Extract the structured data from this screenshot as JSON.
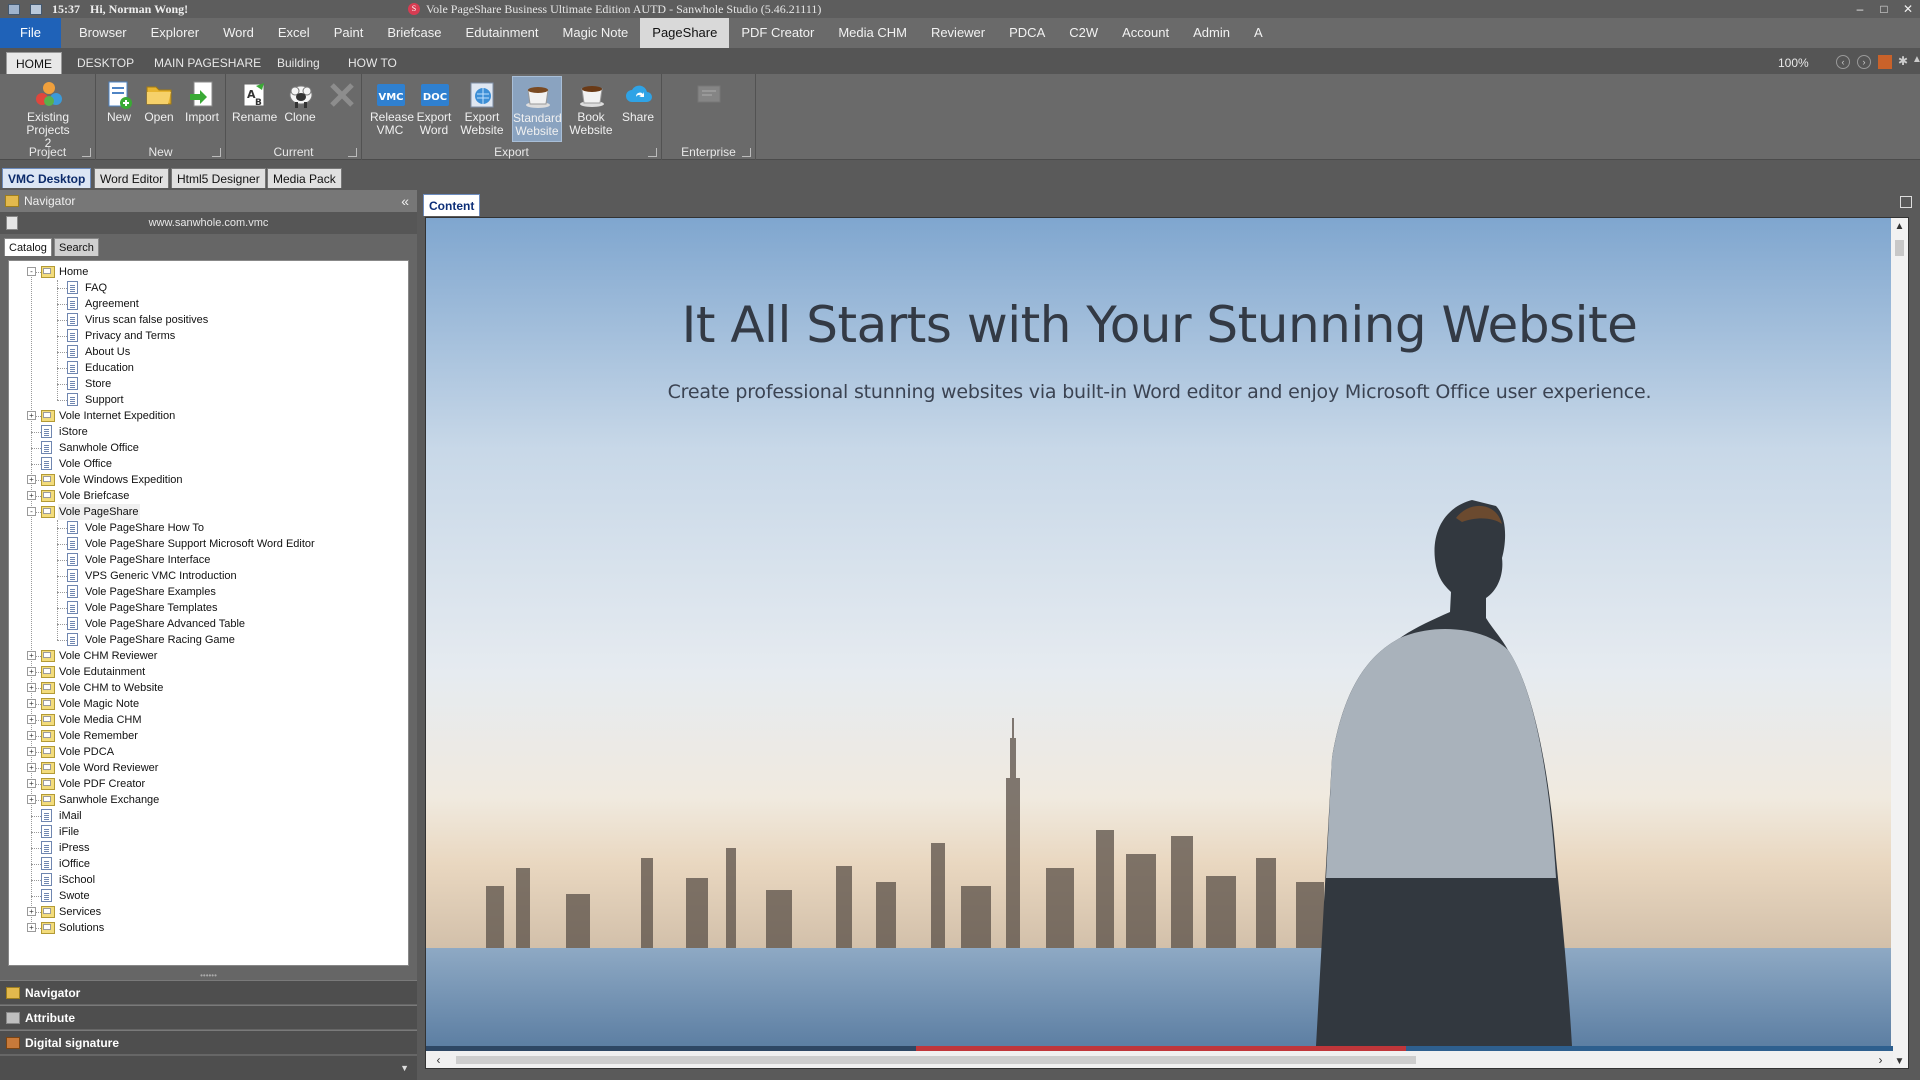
{
  "titlebar": {
    "time": "15:37",
    "greeting": "Hi, Norman Wong!",
    "window_title": "Vole PageShare Business Ultimate Edition AUTD - Sanwhole Studio (5.46.21111)",
    "minimize": "–",
    "maximize": "□",
    "close": "✕"
  },
  "menu": {
    "file": "File",
    "items": [
      "Browser",
      "Explorer",
      "Word",
      "Excel",
      "Paint",
      "Briefcase",
      "Edutainment",
      "Magic Note",
      "PageShare",
      "PDF Creator",
      "Media CHM",
      "Reviewer",
      "PDCA",
      "C2W",
      "Account",
      "Admin",
      "A"
    ],
    "active": "PageShare"
  },
  "subtabs": {
    "items": [
      "HOME",
      "DESKTOP",
      "MAIN PAGESHARE",
      "Building",
      "HOW TO"
    ],
    "active": "HOME",
    "zoom": "100%"
  },
  "ribbon": {
    "project": {
      "label": "Project",
      "existing_line1": "Existing Projects",
      "existing_line2": "2"
    },
    "new_group": {
      "label": "New",
      "new": "New",
      "open": "Open",
      "import": "Import"
    },
    "current": {
      "label": "Current",
      "rename": "Rename",
      "clone": "Clone"
    },
    "export": {
      "label": "Export",
      "release_1": "Release",
      "release_2": "VMC",
      "export_word_1": "Export",
      "export_word_2": "Word",
      "export_web_1": "Export",
      "export_web_2": "Website",
      "standard_1": "Standard",
      "standard_2": "Website",
      "book_1": "Book",
      "book_2": "Website",
      "share": "Share",
      "vmc_icon": "VMC",
      "doc_icon": "DOC"
    },
    "enterprise": {
      "label": "Enterprise"
    }
  },
  "doctabs": [
    "VMC Desktop",
    "Word Editor",
    "Html5 Designer",
    "Media Pack"
  ],
  "navigator": {
    "title": "Navigator",
    "collapse": "«",
    "url": "www.sanwhole.com.vmc",
    "tabs": [
      "Catalog",
      "Search"
    ],
    "tree": [
      {
        "label": "Home",
        "level": 0,
        "type": "folder",
        "exp": "-"
      },
      {
        "label": "FAQ",
        "level": 1,
        "type": "page"
      },
      {
        "label": "Agreement",
        "level": 1,
        "type": "page"
      },
      {
        "label": "Virus scan false positives",
        "level": 1,
        "type": "page"
      },
      {
        "label": "Privacy and Terms",
        "level": 1,
        "type": "page"
      },
      {
        "label": "About Us",
        "level": 1,
        "type": "page"
      },
      {
        "label": "Education",
        "level": 1,
        "type": "page"
      },
      {
        "label": "Store",
        "level": 1,
        "type": "page"
      },
      {
        "label": "Support",
        "level": 1,
        "type": "page"
      },
      {
        "label": "Vole Internet Expedition",
        "level": 0,
        "type": "folder",
        "exp": "+"
      },
      {
        "label": "iStore",
        "level": 0,
        "type": "page"
      },
      {
        "label": "Sanwhole Office",
        "level": 0,
        "type": "page"
      },
      {
        "label": "Vole Office",
        "level": 0,
        "type": "page"
      },
      {
        "label": "Vole Windows Expedition",
        "level": 0,
        "type": "folder",
        "exp": "+"
      },
      {
        "label": "Vole Briefcase",
        "level": 0,
        "type": "folder",
        "exp": "+"
      },
      {
        "label": "Vole PageShare",
        "level": 0,
        "type": "folder",
        "exp": "-",
        "selected": true
      },
      {
        "label": "Vole PageShare How To",
        "level": 1,
        "type": "page"
      },
      {
        "label": "Vole PageShare Support Microsoft Word Editor",
        "level": 1,
        "type": "page"
      },
      {
        "label": "Vole PageShare Interface",
        "level": 1,
        "type": "page"
      },
      {
        "label": "VPS Generic VMC Introduction",
        "level": 1,
        "type": "page"
      },
      {
        "label": "Vole PageShare Examples",
        "level": 1,
        "type": "page"
      },
      {
        "label": "Vole PageShare Templates",
        "level": 1,
        "type": "page"
      },
      {
        "label": "Vole PageShare Advanced Table",
        "level": 1,
        "type": "page"
      },
      {
        "label": "Vole PageShare Racing Game",
        "level": 1,
        "type": "page"
      },
      {
        "label": "Vole CHM Reviewer",
        "level": 0,
        "type": "folder",
        "exp": "+"
      },
      {
        "label": "Vole Edutainment",
        "level": 0,
        "type": "folder",
        "exp": "+"
      },
      {
        "label": "Vole CHM to Website",
        "level": 0,
        "type": "folder",
        "exp": "+"
      },
      {
        "label": "Vole Magic Note",
        "level": 0,
        "type": "folder",
        "exp": "+"
      },
      {
        "label": "Vole Media CHM",
        "level": 0,
        "type": "folder",
        "exp": "+"
      },
      {
        "label": "Vole Remember",
        "level": 0,
        "type": "folder",
        "exp": "+"
      },
      {
        "label": "Vole PDCA",
        "level": 0,
        "type": "folder",
        "exp": "+"
      },
      {
        "label": "Vole Word Reviewer",
        "level": 0,
        "type": "folder",
        "exp": "+"
      },
      {
        "label": "Vole PDF Creator",
        "level": 0,
        "type": "folder",
        "exp": "+"
      },
      {
        "label": "Sanwhole Exchange",
        "level": 0,
        "type": "folder",
        "exp": "+"
      },
      {
        "label": "iMail",
        "level": 0,
        "type": "page"
      },
      {
        "label": "iFile",
        "level": 0,
        "type": "page"
      },
      {
        "label": "iPress",
        "level": 0,
        "type": "page"
      },
      {
        "label": "iOffice",
        "level": 0,
        "type": "page"
      },
      {
        "label": "iSchool",
        "level": 0,
        "type": "page"
      },
      {
        "label": "Swote",
        "level": 0,
        "type": "page"
      },
      {
        "label": "Services",
        "level": 0,
        "type": "folder",
        "exp": "+"
      },
      {
        "label": "Solutions",
        "level": 0,
        "type": "folder",
        "exp": "+"
      }
    ]
  },
  "bottom_panels": [
    "Navigator",
    "Attribute",
    "Digital signature"
  ],
  "content": {
    "tab": "Content",
    "hero_title": "It All Starts with Your Stunning Website",
    "hero_subtitle": "Create professional stunning websites via built-in Word editor and enjoy Microsoft Office user experience."
  },
  "colors": {
    "file_blue": "#1f62b8",
    "strip_red": "#c0363a",
    "strip_navy": "#2e4764"
  }
}
